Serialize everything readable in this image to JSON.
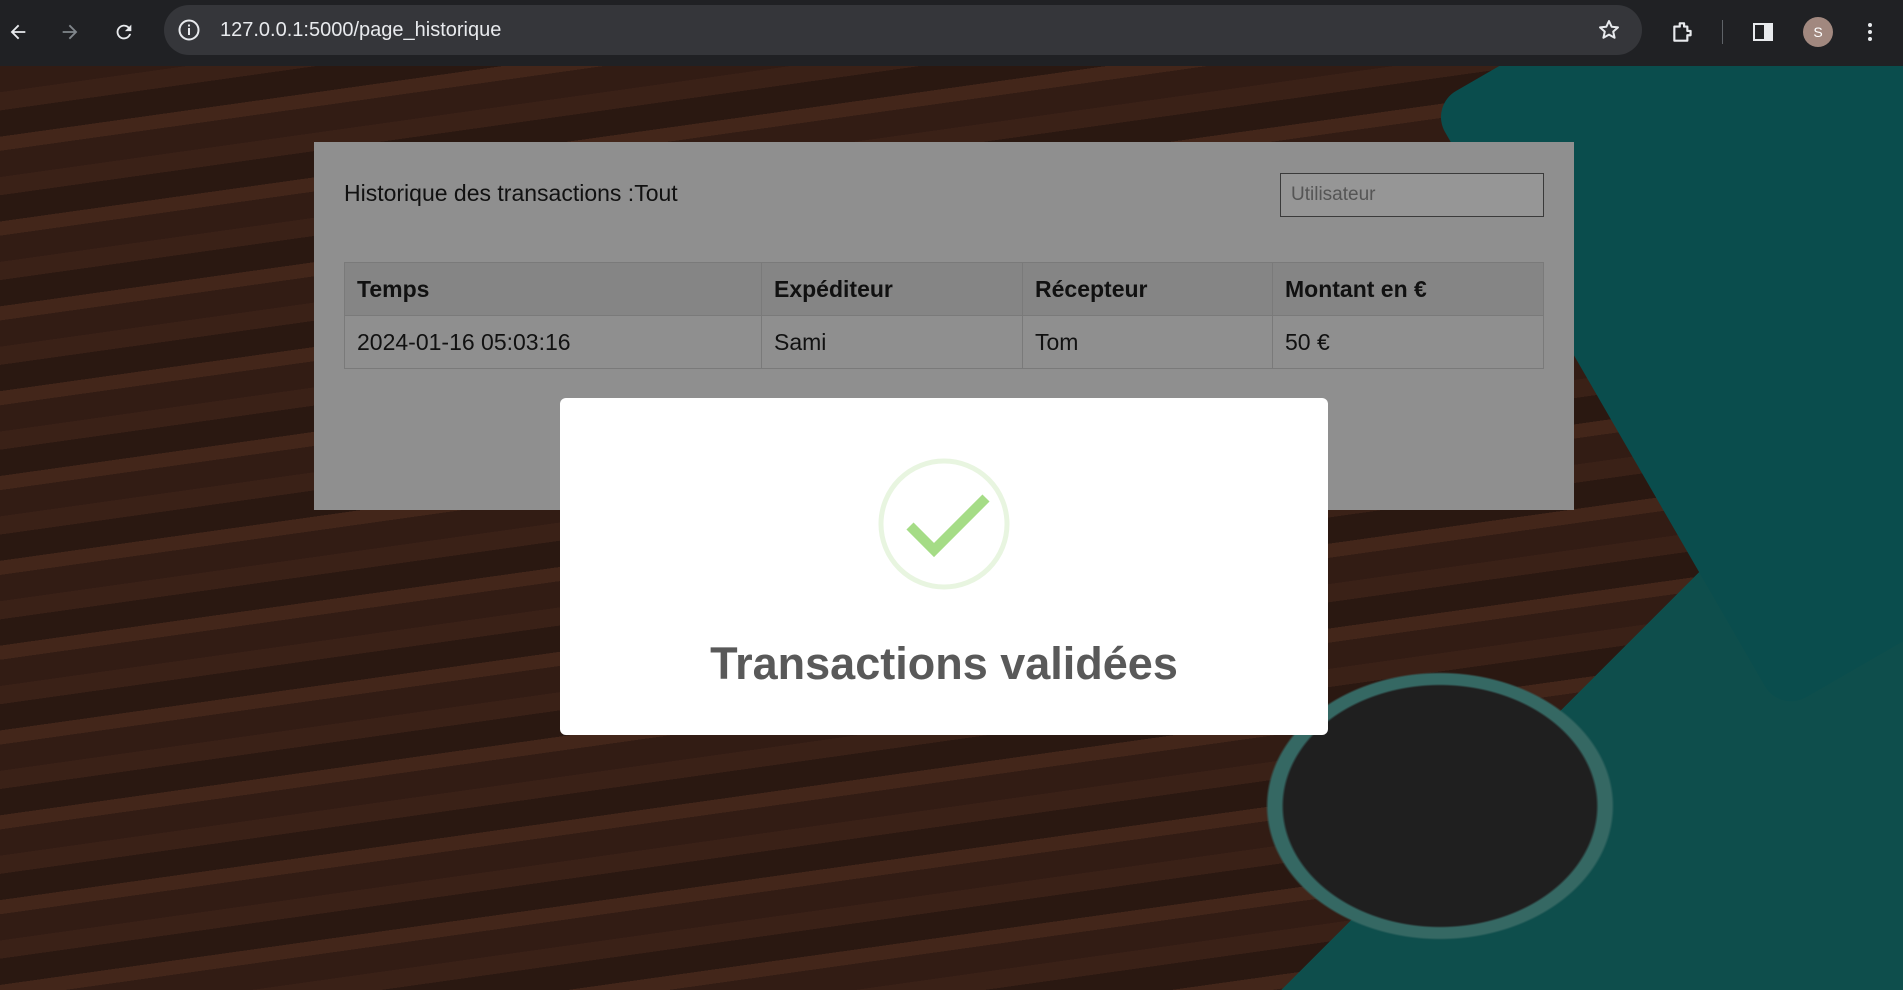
{
  "browser": {
    "url": "127.0.0.1:5000/page_historique",
    "profile_initial": "S"
  },
  "history": {
    "title": "Historique des transactions :Tout",
    "user_placeholder": "Utilisateur",
    "columns": [
      "Temps",
      "Expéditeur",
      "Récepteur",
      "Montant en €"
    ],
    "rows": [
      [
        "2024-01-16 05:03:16",
        "Sami",
        "Tom",
        "50 €"
      ]
    ]
  },
  "modal": {
    "title": "Transactions validées",
    "icon": "success-check-icon",
    "accent_color": "#a5dc86"
  }
}
